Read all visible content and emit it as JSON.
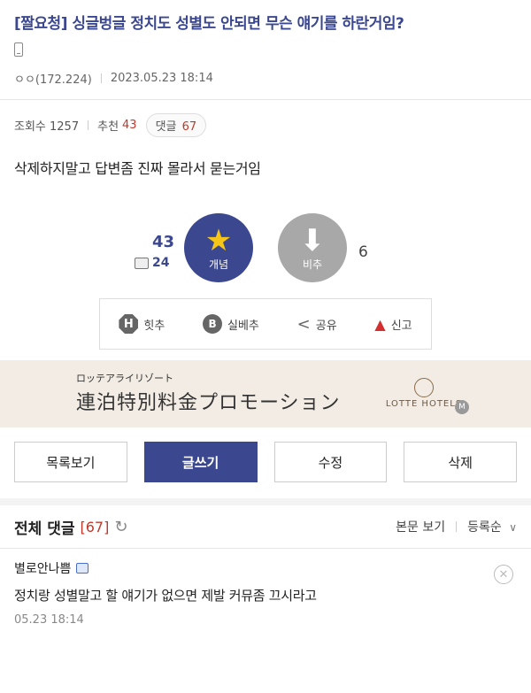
{
  "post": {
    "title": "[짤요청] 싱글벙글 정치도 성별도 안되면 무슨 얘기를 하란거임?",
    "author": "ㅇㅇ(172.224)",
    "datetime": "2023.05.23 18:14",
    "views_label": "조회수 1257",
    "recommend_label": "추천",
    "recommend_count": "43",
    "comments_label": "댓글",
    "comments_count": "67",
    "body": "삭제하지말고 답변좀 진짜 몰라서 묻는거임"
  },
  "votes": {
    "up_count": "43",
    "gall_count": "24",
    "up_label": "개념",
    "down_label": "비추",
    "down_count": "6"
  },
  "actions": {
    "hit_label": "힛추",
    "best_label": "실베추",
    "share_label": "공유",
    "report_label": "신고",
    "hit_icon_char": "H",
    "best_icon_char": "B"
  },
  "ad": {
    "sub": "ロッテアライリゾート",
    "main": "連泊特別料金プロモーション",
    "brand": "LOTTE HOTELS",
    "badge": "M"
  },
  "buttons": {
    "list": "목록보기",
    "write": "글쓰기",
    "edit": "수정",
    "delete": "삭제"
  },
  "comments_section": {
    "title": "전체 댓글",
    "count": "[67]",
    "view_body": "본문 보기",
    "sort": "등록순"
  },
  "comments": [
    {
      "author": "별로안나쁨",
      "text": "정치랑 성별말고 할 얘기가 없으면 제발 커뮤좀 끄시라고",
      "date": "05.23 18:14"
    }
  ],
  "colors": {
    "accent": "#3b4890",
    "star": "#f5c518",
    "count_red": "#c0392b",
    "ad_bg": "#f2ece4"
  },
  "icons": {
    "mobile": "mobile-phone-icon",
    "star": "star-icon",
    "arrow_down": "arrow-down-icon",
    "share": "share-icon",
    "siren": "siren-icon",
    "refresh": "refresh-icon",
    "chevron": "chevron-down-icon",
    "close": "close-icon"
  }
}
